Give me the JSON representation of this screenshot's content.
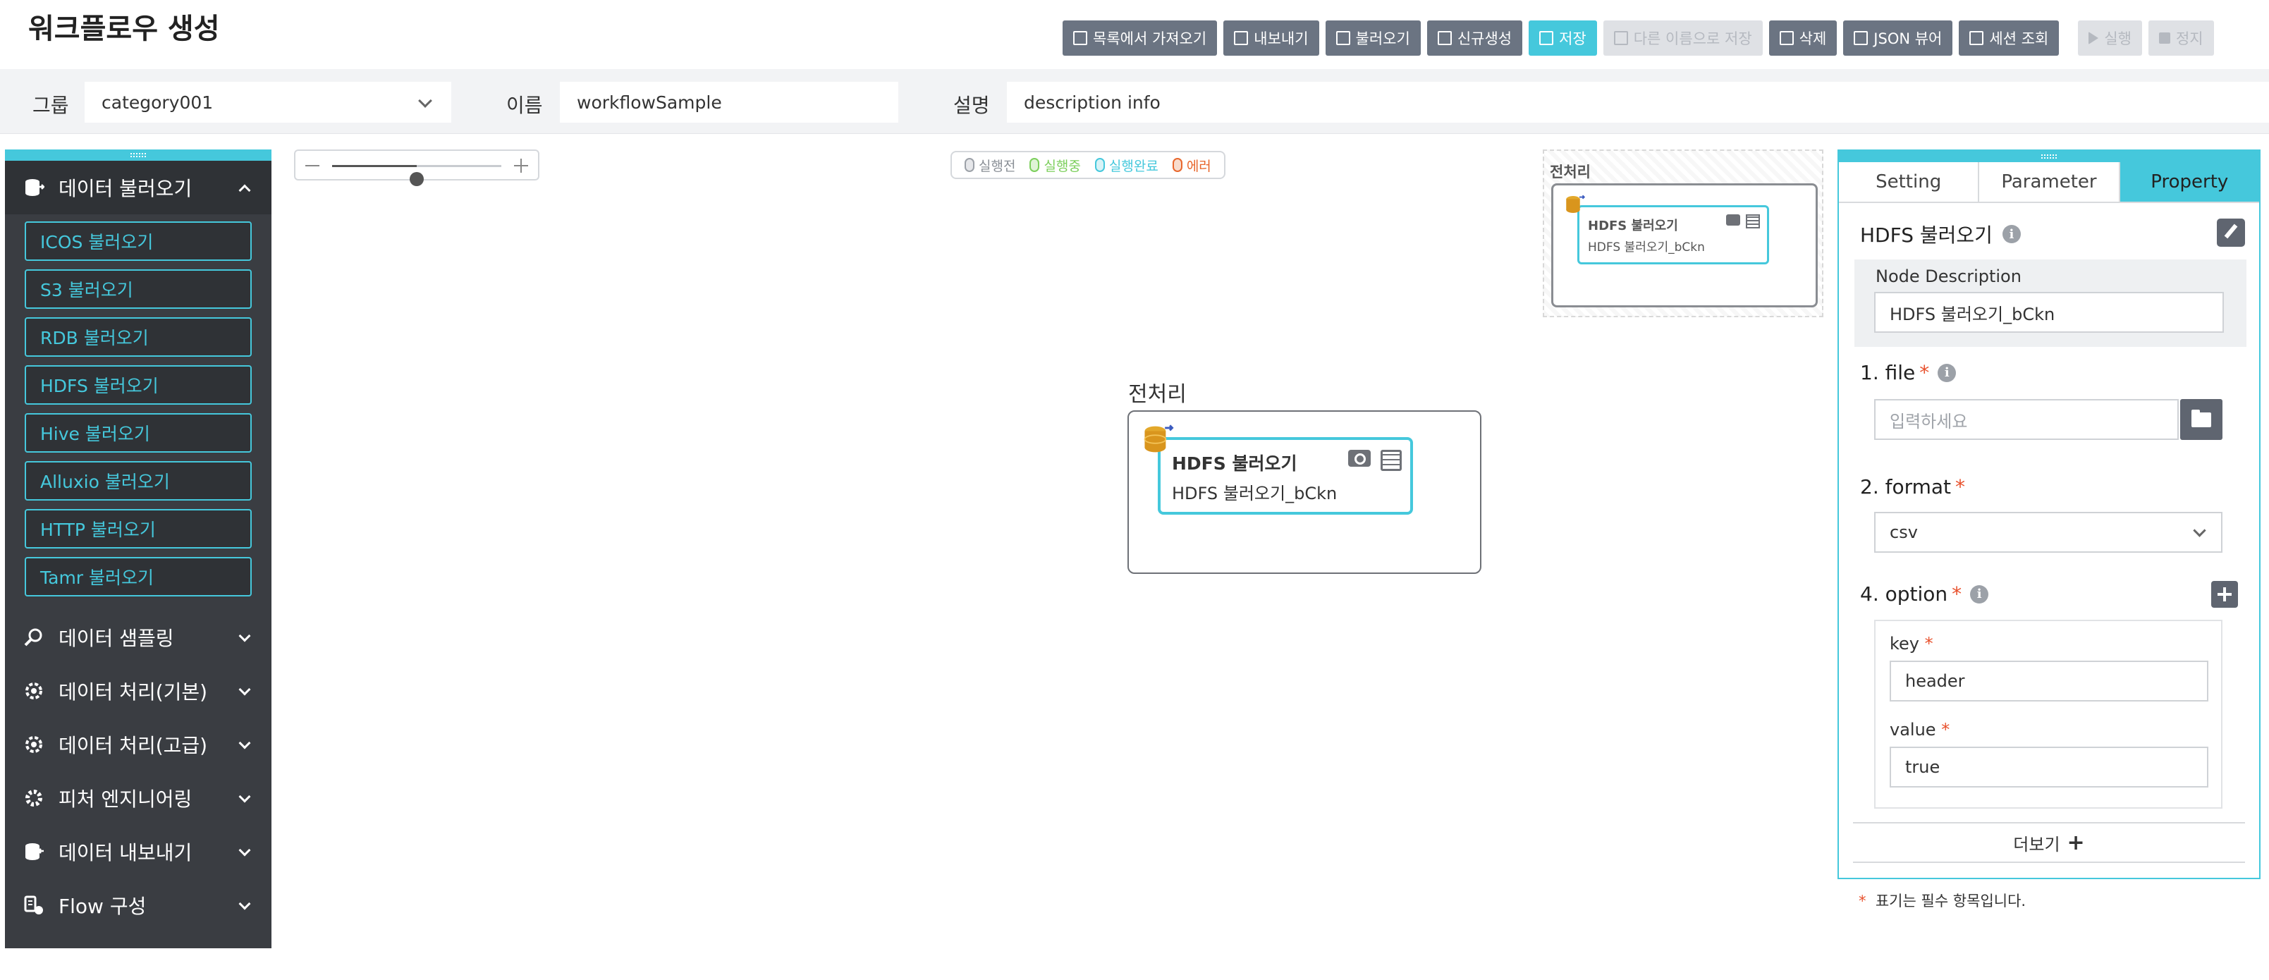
{
  "header": {
    "title": "워크플로우 생성",
    "toolbar": [
      {
        "label": "목록에서 가져오기",
        "icon": "list-icon",
        "state": "normal"
      },
      {
        "label": "내보내기",
        "icon": "export-icon",
        "state": "normal"
      },
      {
        "label": "불러오기",
        "icon": "folder-open-icon",
        "state": "normal"
      },
      {
        "label": "신규생성",
        "icon": "plus-square-icon",
        "state": "normal"
      },
      {
        "label": "저장",
        "icon": "save-icon",
        "state": "primary"
      },
      {
        "label": "다른 이름으로 저장",
        "icon": "save-as-icon",
        "state": "disabled"
      },
      {
        "label": "삭제",
        "icon": "trash-icon",
        "state": "normal"
      },
      {
        "label": "JSON 뷰어",
        "icon": "code-icon",
        "state": "normal"
      },
      {
        "label": "세션 조회",
        "icon": "search-doc-icon",
        "state": "normal"
      },
      {
        "label": "실행",
        "icon": "play-icon",
        "state": "disabled"
      },
      {
        "label": "정지",
        "icon": "stop-icon",
        "state": "disabled"
      }
    ]
  },
  "meta": {
    "group_label": "그룹",
    "group_value": "category001",
    "name_label": "이름",
    "name_value": "workflowSample",
    "desc_label": "설명",
    "desc_value": "description info"
  },
  "sidebar": {
    "categories": [
      {
        "label": "데이터 불러오기",
        "icon": "database-import-icon",
        "open": true,
        "items": [
          "ICOS 불러오기",
          "S3 불러오기",
          "RDB 불러오기",
          "HDFS 불러오기",
          "Hive 불러오기",
          "Alluxio 불러오기",
          "HTTP 불러오기",
          "Tamr 불러오기"
        ]
      },
      {
        "label": "데이터 샘플링",
        "icon": "magnifier-icon",
        "open": false
      },
      {
        "label": "데이터 처리(기본)",
        "icon": "gear-icon",
        "open": false
      },
      {
        "label": "데이터 처리(고급)",
        "icon": "gear-icon",
        "open": false
      },
      {
        "label": "피처 엔지니어링",
        "icon": "cog-icon",
        "open": false
      },
      {
        "label": "데이터 내보내기",
        "icon": "database-export-icon",
        "open": false
      },
      {
        "label": "Flow 구성",
        "icon": "flow-icon",
        "open": false
      }
    ]
  },
  "canvas": {
    "zoom_level": 0.5,
    "legend": [
      {
        "label": "실행전",
        "color": "#9ca1a8"
      },
      {
        "label": "실행중",
        "color": "#7ccf5c"
      },
      {
        "label": "실행완료",
        "color": "#45c8dc"
      },
      {
        "label": "에러",
        "color": "#e8672d"
      }
    ],
    "group_title": "전처리",
    "node": {
      "title": "HDFS 불러오기",
      "name": "HDFS 불러오기_bCkn"
    },
    "minimap": {
      "title": "전처리",
      "node_title": "HDFS 불러오기",
      "node_name": "HDFS 불러오기_bCkn"
    }
  },
  "panel": {
    "tabs": [
      "Setting",
      "Parameter",
      "Property"
    ],
    "active_tab": "Property",
    "title": "HDFS 불러오기",
    "node_description_label": "Node Description",
    "node_description_value": "HDFS 불러오기_bCkn",
    "file_label": "1. file",
    "file_placeholder": "입력하세요",
    "format_label": "2. format",
    "format_value": "csv",
    "option_label": "4. option",
    "option_key_label": "key",
    "option_key_value": "header",
    "option_value_label": "value",
    "option_value_value": "true",
    "more_label": "더보기",
    "required_mark": "*",
    "required_note": "표기는 필수 항목입니다."
  },
  "colors": {
    "accent": "#45c8dc",
    "toolbar": "#6b7482",
    "sidebar": "#3a3d42",
    "required": "#e8512d"
  }
}
